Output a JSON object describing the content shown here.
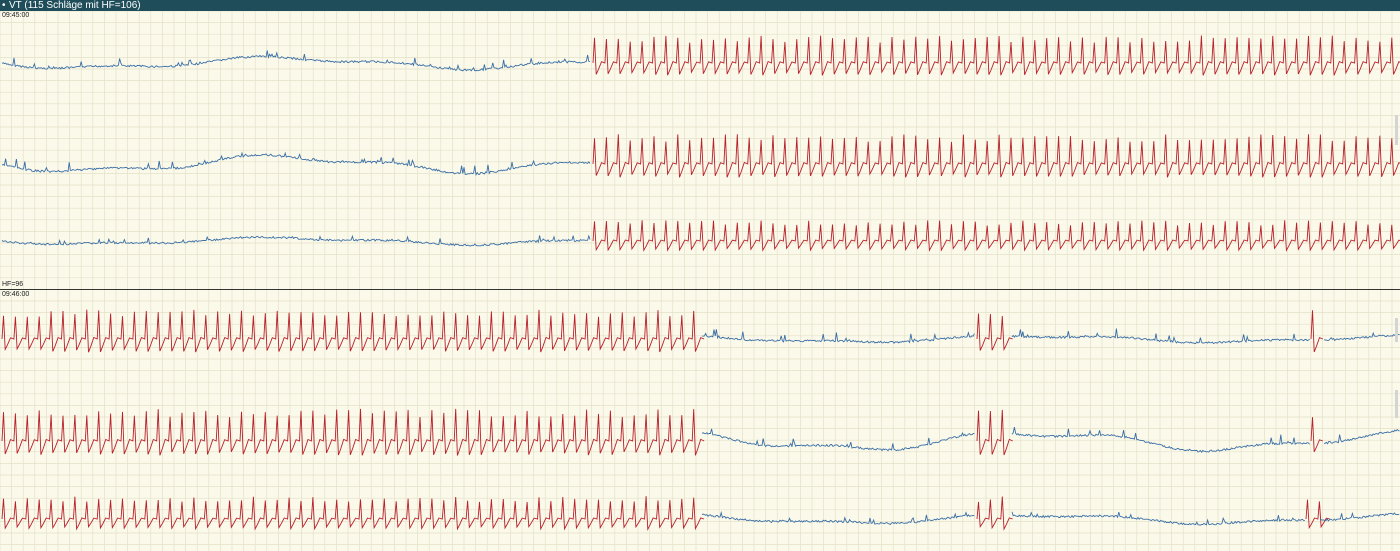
{
  "header": {
    "title": "VT (115 Schläge mit HF=106)"
  },
  "strips": [
    {
      "time_label": "09:45:00",
      "hr_label": ""
    },
    {
      "time_label": "09:46:00",
      "hr_label": "HF=96"
    }
  ],
  "colors": {
    "title_bar": "#1f4e5a",
    "background": "#fbf9ea",
    "grid": "#e3e1c8",
    "normal_beat": "#3a6fa6",
    "vt_beat": "#b8202a",
    "baseline": "#555555"
  },
  "icons": {
    "title_bullet": "bullet-icon"
  }
}
